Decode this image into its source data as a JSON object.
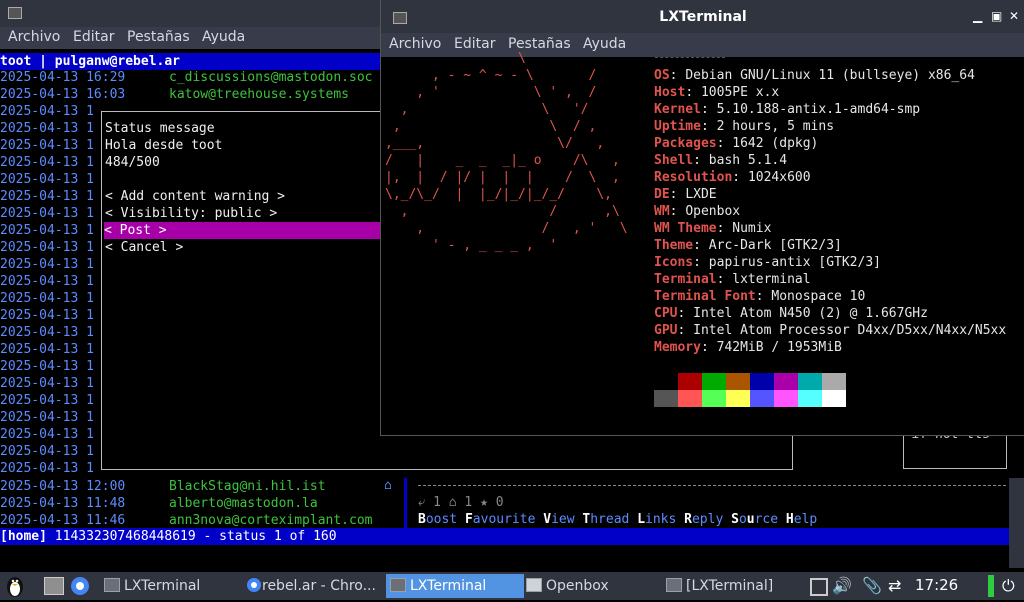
{
  "back_window": {
    "menu": [
      "Archivo",
      "Editar",
      "Pestañas",
      "Ayuda"
    ],
    "header": "toot | pulganw@rebel.ar",
    "timeline": [
      {
        "date": "2025-04-13 16:29",
        "account": "c_discussions@mastodon.soc"
      },
      {
        "date": "2025-04-13 16:03",
        "account": "katow@treehouse.systems"
      },
      {
        "date": "2025-04-13 1",
        "account": ""
      },
      {
        "date": "2025-04-13 1",
        "account": ""
      },
      {
        "date": "2025-04-13 1",
        "account": ""
      },
      {
        "date": "2025-04-13 1",
        "account": ""
      },
      {
        "date": "2025-04-13 1",
        "account": ""
      },
      {
        "date": "2025-04-13 1",
        "account": ""
      },
      {
        "date": "2025-04-13 1",
        "account": ""
      },
      {
        "date": "2025-04-13 1",
        "account": ""
      },
      {
        "date": "2025-04-13 1",
        "account": ""
      },
      {
        "date": "2025-04-13 1",
        "account": ""
      },
      {
        "date": "2025-04-13 1",
        "account": ""
      },
      {
        "date": "2025-04-13 1",
        "account": ""
      },
      {
        "date": "2025-04-13 1",
        "account": ""
      },
      {
        "date": "2025-04-13 1",
        "account": ""
      },
      {
        "date": "2025-04-13 1",
        "account": ""
      },
      {
        "date": "2025-04-13 1",
        "account": ""
      },
      {
        "date": "2025-04-13 1",
        "account": ""
      },
      {
        "date": "2025-04-13 1",
        "account": ""
      },
      {
        "date": "2025-04-13 1",
        "account": ""
      },
      {
        "date": "2025-04-13 1",
        "account": ""
      },
      {
        "date": "2025-04-13 1",
        "account": ""
      },
      {
        "date": "2025-04-13 1",
        "account": ""
      },
      {
        "date": "2025-04-13 12:00",
        "account": "BlackStag@ni.hil.ist"
      },
      {
        "date": "2025-04-13 11:48",
        "account": "alberto@mastodon.la"
      },
      {
        "date": "2025-04-13 11:46",
        "account": "ann3nova@corteximplant.com"
      }
    ],
    "dialog": {
      "title": "Status message",
      "text": "Hola desde toot",
      "counter": "484/500",
      "content_warning": "< Add content warning >",
      "visibility": "< Visibility: public >",
      "post": "< Post >",
      "cancel": "< Cancel >"
    },
    "side_fragment": "if not tls",
    "arrow_char": "⌂",
    "stats_line": "⤶ 1 ⌂ 1 ★ 0",
    "actions": [
      {
        "key": "B",
        "rest": "oost "
      },
      {
        "key": "F",
        "rest": "avourite "
      },
      {
        "key": "V",
        "rest": "iew "
      },
      {
        "key": "T",
        "rest": "hread "
      },
      {
        "key": "L",
        "rest": "inks "
      },
      {
        "key": "R",
        "rest": "eply "
      },
      {
        "key": "S",
        "rest": "o"
      },
      {
        "key": "u",
        "rest": "rce "
      },
      {
        "key": "H",
        "rest": "elp"
      }
    ],
    "status_bar": {
      "mode": "[home]",
      "text": " 114332307468448619 - status 1 of 160"
    }
  },
  "front_window": {
    "title": "LXTerminal",
    "menu": [
      "Archivo",
      "Editar",
      "Pestañas",
      "Ayuda"
    ],
    "logo_lines": [
      "                 \\        ",
      "      , - ~ ^ ~ - \\       /",
      "    , '            \\ ' ,  /",
      "  ,                 \\   '/",
      " ,                   \\  / ,",
      ",___,                 \\/   ,",
      "/   |    _  _  _|_ o    /\\   ,",
      "|,  |  / |/ |  |  |    /  \\  ,",
      "\\,_/\\_/  |  |_/|_/|_/_/    \\,",
      "  ,                  /      ,\\",
      "    ,               /   , '   \\",
      "      ' - , _ _ _ ,  '"
    ],
    "info": [
      {
        "key": "OS",
        "value": "Debian GNU/Linux 11 (bullseye) x86_64"
      },
      {
        "key": "Host",
        "value": "1005PE x.x"
      },
      {
        "key": "Kernel",
        "value": "5.10.188-antix.1-amd64-smp"
      },
      {
        "key": "Uptime",
        "value": "2 hours, 5 mins"
      },
      {
        "key": "Packages",
        "value": "1642 (dpkg)"
      },
      {
        "key": "Shell",
        "value": "bash 5.1.4"
      },
      {
        "key": "Resolution",
        "value": "1024x600"
      },
      {
        "key": "DE",
        "value": "LXDE"
      },
      {
        "key": "WM",
        "value": "Openbox"
      },
      {
        "key": "WM Theme",
        "value": "Numix"
      },
      {
        "key": "Theme",
        "value": "Arc-Dark [GTK2/3]"
      },
      {
        "key": "Icons",
        "value": "papirus-antix [GTK2/3]"
      },
      {
        "key": "Terminal",
        "value": "lxterminal"
      },
      {
        "key": "Terminal Font",
        "value": "Monospace 10"
      },
      {
        "key": "CPU",
        "value": "Intel Atom N450 (2) @ 1.667GHz"
      },
      {
        "key": "GPU",
        "value": "Intel Atom Processor D4xx/D5xx/N4xx/N5xx"
      },
      {
        "key": "Memory",
        "value": "742MiB / 1953MiB"
      }
    ],
    "palette_top": [
      "#000000",
      "#aa0000",
      "#00aa00",
      "#aa5500",
      "#0000aa",
      "#aa00aa",
      "#00aaaa",
      "#aaaaaa"
    ],
    "palette_bottom": [
      "#555555",
      "#ff5555",
      "#55ff55",
      "#ffff55",
      "#5555ff",
      "#ff55ff",
      "#55ffff",
      "#ffffff"
    ]
  },
  "taskbar": {
    "tasks": [
      "LXTerminal",
      "rebel.ar - Chro...",
      "LXTerminal",
      "Openbox",
      "[LXTerminal]"
    ],
    "clock": "17:26"
  }
}
